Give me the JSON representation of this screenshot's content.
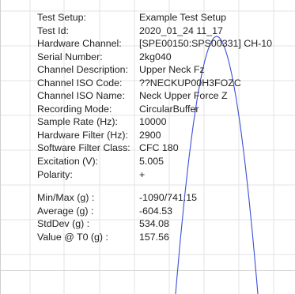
{
  "setup": [
    {
      "label": "Test Setup:",
      "value": "Example Test Setup"
    },
    {
      "label": "Test Id:",
      "value": "2020_01_24 11_17"
    },
    {
      "label": "Hardware Channel:",
      "value": "[SPE00150:SPS00331] CH-10"
    },
    {
      "label": "Serial Number:",
      "value": "2kg040"
    },
    {
      "label": "Channel Description:",
      "value": "Upper Neck Fz"
    },
    {
      "label": "Channel ISO Code:",
      "value": "??NECKUP00H3FOZC"
    },
    {
      "label": "Channel ISO Name:",
      "value": "Neck Upper Force Z"
    },
    {
      "label": "Recording Mode:",
      "value": "CircularBuffer"
    },
    {
      "label": "Sample Rate (Hz):",
      "value": "10000"
    },
    {
      "label": "Hardware Filter (Hz):",
      "value": "2900"
    },
    {
      "label": "Software Filter Class:",
      "value": "CFC 180"
    },
    {
      "label": "Excitation (V):",
      "value": "5.005"
    },
    {
      "label": "Polarity:",
      "value": "+"
    }
  ],
  "stats": [
    {
      "label": "Min/Max (g) :",
      "value": "-1090/741.15"
    },
    {
      "label": "Average (g) :",
      "value": "-604.53"
    },
    {
      "label": "StdDev (g) :",
      "value": "534.08"
    },
    {
      "label": "Value @ T0 (g) :",
      "value": "157.56"
    }
  ],
  "colors": {
    "grid": "#e3e3e3",
    "curve": "#3a4fd8",
    "frame": "#cfcfcf"
  }
}
